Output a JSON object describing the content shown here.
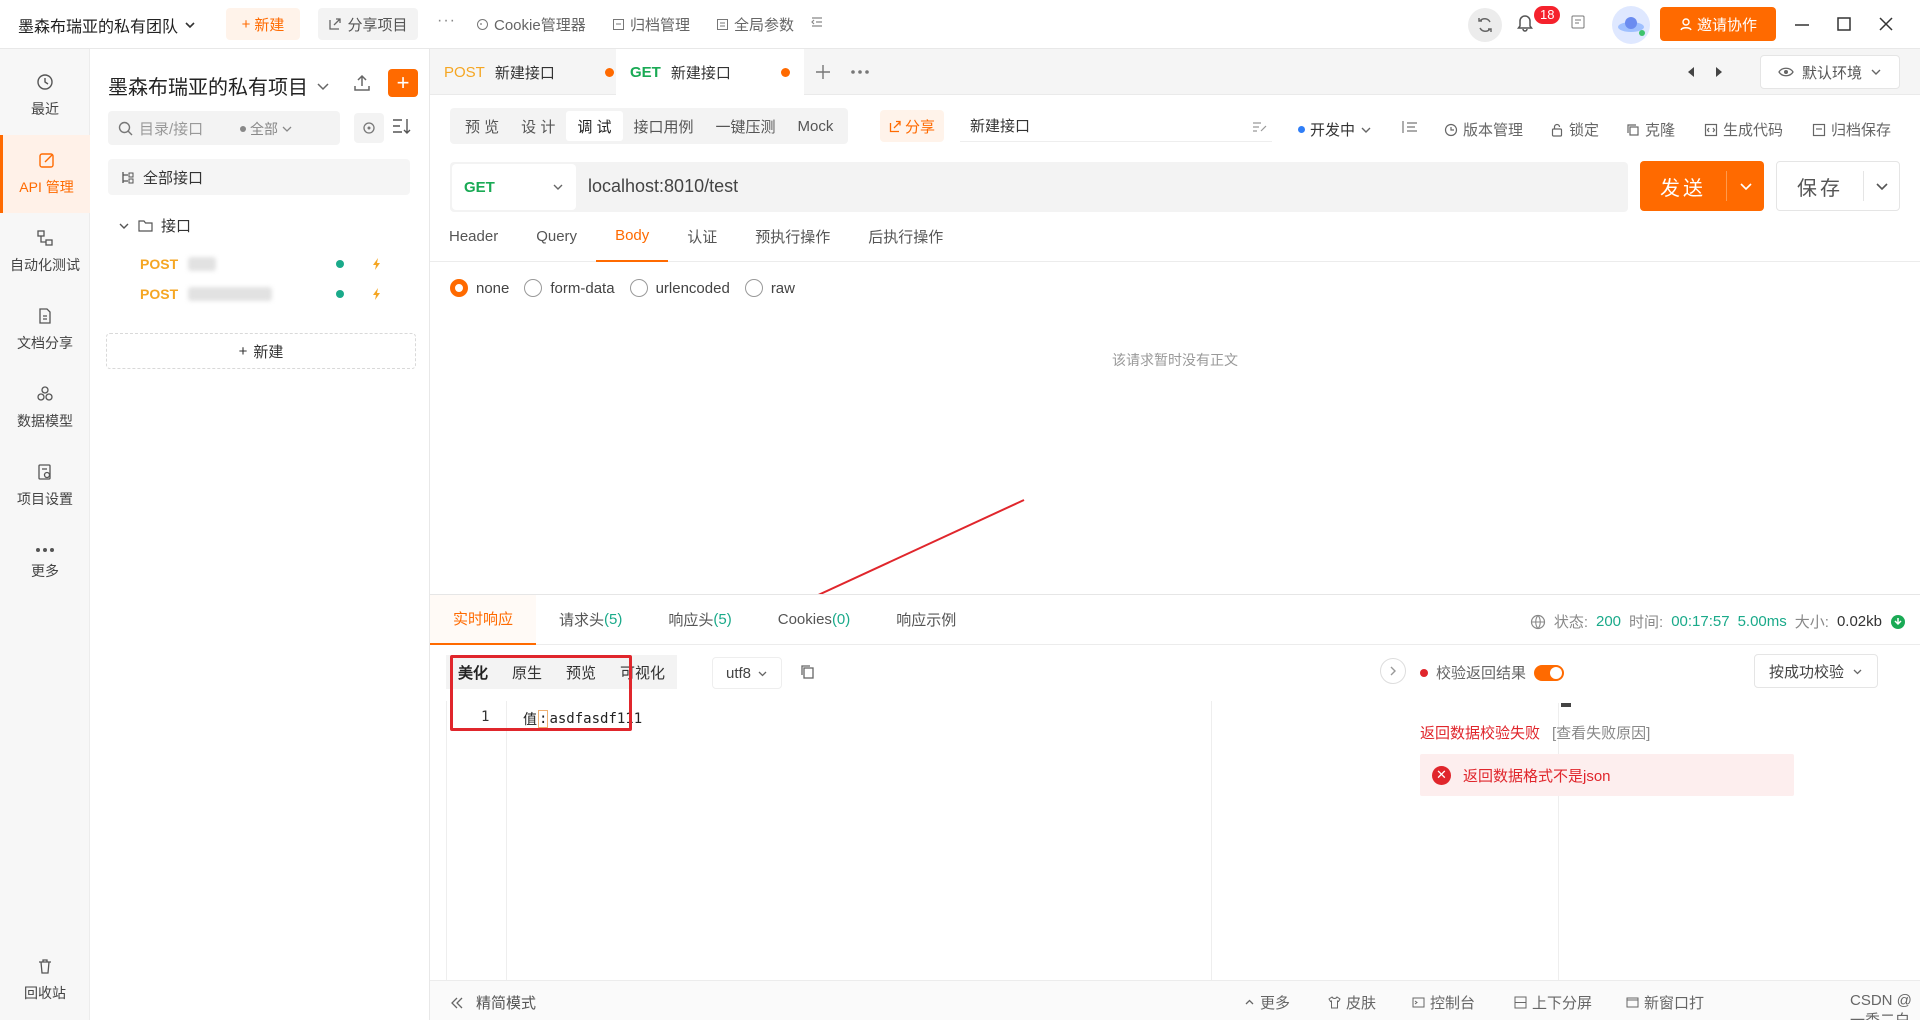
{
  "topbar": {
    "team": "墨森布瑞亚的私有团队",
    "new": "新建",
    "share_project": "分享项目",
    "more": "···",
    "cookie": "Cookie管理器",
    "archive": "归档管理",
    "global": "全局参数",
    "notif_count": "18",
    "invite": "邀请协作"
  },
  "rail": {
    "items": [
      {
        "label": "最近",
        "icon": "history-icon"
      },
      {
        "label": "API 管理",
        "icon": "api-edit-icon"
      },
      {
        "label": "自动化测试",
        "icon": "flow-icon"
      },
      {
        "label": "文档分享",
        "icon": "doc-icon"
      },
      {
        "label": "数据模型",
        "icon": "model-icon"
      },
      {
        "label": "项目设置",
        "icon": "settings-icon"
      },
      {
        "label": "更多",
        "icon": "more-icon"
      }
    ],
    "trash": "回收站"
  },
  "tree": {
    "project": "墨森布瑞亚的私有项目",
    "search_placeholder": "目录/接口",
    "filter": "全部",
    "all_api": "全部接口",
    "folder": "接口",
    "apis": [
      {
        "method": "POST"
      },
      {
        "method": "POST"
      }
    ],
    "new": "新建"
  },
  "tabs": [
    {
      "method": "POST",
      "name": "新建接口"
    },
    {
      "method": "GET",
      "name": "新建接口"
    }
  ],
  "env": "默认环境",
  "modes": [
    "预 览",
    "设 计",
    "调 试",
    "接口用例",
    "一键压测",
    "Mock"
  ],
  "share": "分享",
  "api_name": "新建接口",
  "status_select": "开发中",
  "tools": [
    "版本管理",
    "锁定",
    "克隆",
    "生成代码",
    "归档保存"
  ],
  "request": {
    "method": "GET",
    "url": "localhost:8010/test",
    "send": "发送",
    "save": "保存"
  },
  "req_tabs": [
    "Header",
    "Query",
    "Body",
    "认证",
    "预执行操作",
    "后执行操作"
  ],
  "body_types": [
    "none",
    "form-data",
    "urlencoded",
    "raw"
  ],
  "no_body": "该请求暂时没有正文",
  "resp_tabs": [
    {
      "label": "实时响应",
      "count": ""
    },
    {
      "label": "请求头",
      "count": "(5)"
    },
    {
      "label": "响应头",
      "count": "(5)"
    },
    {
      "label": "Cookies",
      "count": "(0)"
    },
    {
      "label": "响应示例",
      "count": ""
    }
  ],
  "resp_status": {
    "status_label": "状态:",
    "status": "200",
    "time_label": "时间:",
    "time": "00:17:57",
    "duration": "5.00ms",
    "size_label": "大小:",
    "size": "0.02kb"
  },
  "fmt": [
    "美化",
    "原生",
    "预览",
    "可视化"
  ],
  "encoding": "utf8",
  "code": {
    "line": "1",
    "key": "值",
    "colon": ":",
    "value": "asdfasdf111"
  },
  "validate": {
    "label": "校验返回结果",
    "mode": "按成功校验",
    "fail": "返回数据校验失败",
    "fail_link": "[查看失败原因]",
    "error": "返回数据格式不是json"
  },
  "footer": {
    "simple": "精简模式",
    "more": "更多",
    "skin": "皮肤",
    "console": "控制台",
    "split": "上下分屏",
    "new_window": "新窗口打",
    "watermark": "CSDN @一秀二白三面板"
  }
}
